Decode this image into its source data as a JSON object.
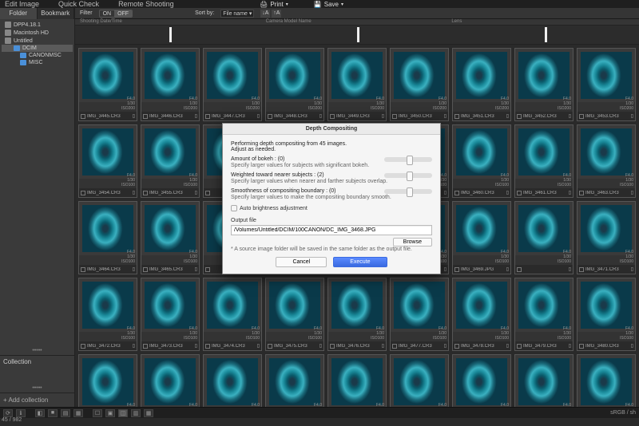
{
  "topbar": {
    "edit_image": "Edit Image",
    "quick_check": "Quick Check",
    "remote_shooting": "Remote Shooting",
    "print": "Print",
    "save": "Save"
  },
  "toolbar": {
    "filter_label": "Filter",
    "on": "ON",
    "off": "OFF",
    "sort_label": "Sort by:",
    "sort_value": "File name"
  },
  "meta": {
    "h1": "Shooting Date/Time",
    "h2": "Camera Model Name",
    "h3": "Lens"
  },
  "sidebar": {
    "tab_folder": "Folder",
    "tab_bookmark": "Bookmark",
    "items": [
      {
        "label": "DPP4.18.1"
      },
      {
        "label": "Macintosh HD"
      },
      {
        "label": "Untitled"
      },
      {
        "label": "DCIM"
      },
      {
        "label": "CANONMSC"
      },
      {
        "label": "MISC"
      }
    ],
    "collection": "Collection",
    "add_collection": "+  Add collection"
  },
  "thumbs": {
    "aperture": "F4.0",
    "shutter": "1/30",
    "iso": "ISO100",
    "iso2": "ISO200",
    "names": [
      "IMG_3445.CR3",
      "IMG_3446.CR3",
      "IMG_3447.CR3",
      "IMG_3448.CR3",
      "IMG_3449.CR3",
      "IMG_3450.CR3",
      "IMG_3451.CR3",
      "IMG_3452.CR3",
      "IMG_3453.CR3",
      "IMG_3454.CR3",
      "IMG_3455.CR3",
      "",
      "",
      "",
      "",
      "IMG_3460.CR3",
      "IMG_3461.CR3",
      "IMG_3463.CR3",
      "IMG_3464.CR3",
      "IMG_3465.CR3",
      "",
      "",
      "",
      "",
      "IMG_3469.JPG",
      "",
      "IMG_3471.CR3",
      "IMG_3472.CR3",
      "IMG_3473.CR3",
      "IMG_3474.CR3",
      "IMG_3475.CR3",
      "IMG_3476.CR3",
      "IMG_3477.CR3",
      "IMG_3478.CR3",
      "IMG_3479.CR3",
      "IMG_3480.CR3",
      "",
      "",
      "",
      "",
      "",
      "",
      "",
      "",
      ""
    ]
  },
  "dialog": {
    "title": "Depth Compositing",
    "intro1": "Performing depth compositing from 45 images.",
    "intro2": "Adjust as needed.",
    "bokeh_label": "Amount of bokeh : (0)",
    "bokeh_desc": "Specify larger values for subjects with significant bokeh.",
    "weight_label": "Weighted toward nearer subjects : (2)",
    "weight_desc": "Specify larger values when nearer and farther subjects overlap.",
    "smooth_label": "Smoothness of compositing boundary : (0)",
    "smooth_desc": "Specify larger values to make the compositing boundary smooth.",
    "auto_bright": "Auto brightness adjustment",
    "output_label": "Output file",
    "output_value": "/Volumes/Untitled/DCIM/100CANON/DC_IMG_3468.JPG",
    "browse": "Browse",
    "note": "* A source image folder will be saved in the same folder as the output file.",
    "cancel": "Cancel",
    "execute": "Execute"
  },
  "status": {
    "count": "45 / 982",
    "colorspace": "sRGB / sh"
  }
}
